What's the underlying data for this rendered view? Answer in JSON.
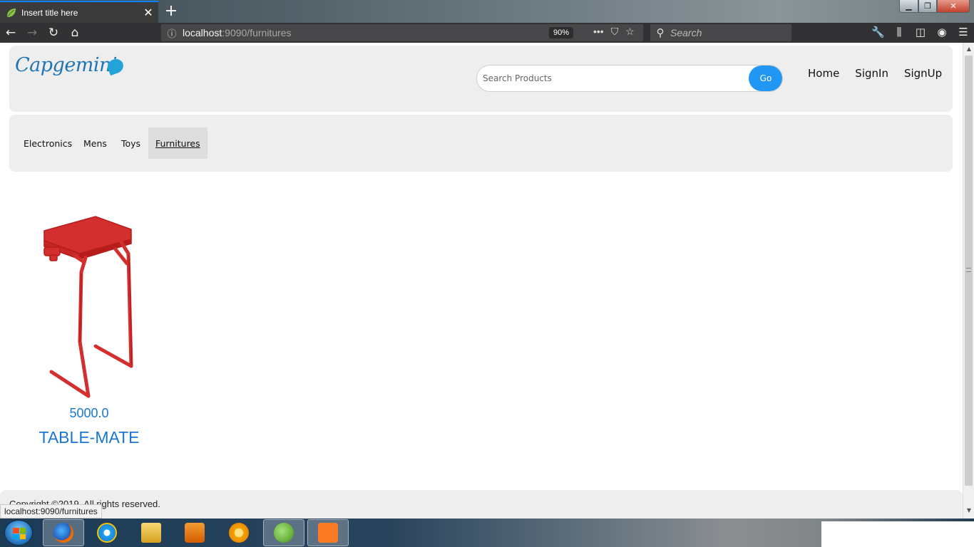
{
  "browser": {
    "tab_title": "Insert title here",
    "tab_close": "✕",
    "new_tab": "+",
    "url_host": "localhost",
    "url_path": ":9090/furnitures",
    "zoom": "90%",
    "search_placeholder": "Search",
    "status_url": "localhost:9090/furnitures",
    "window_controls": {
      "min": "▁",
      "max": "❐",
      "close": "✕"
    }
  },
  "header": {
    "logo_text": "Capgemini",
    "search_placeholder": "Search Products",
    "go_label": "Go",
    "links": [
      "Home",
      "SignIn",
      "SignUp"
    ]
  },
  "categories": [
    {
      "label": "Electronics",
      "active": false
    },
    {
      "label": "Mens",
      "active": false
    },
    {
      "label": "Toys",
      "active": false
    },
    {
      "label": "Furnitures",
      "active": true
    }
  ],
  "products": [
    {
      "price": "5000.0",
      "name": "TABLE-MATE",
      "color": "#d32f2f"
    }
  ],
  "footer": {
    "text": "Copyright ©2019. All rights reserved."
  },
  "taskbar": {
    "apps": [
      "firefox-icon",
      "internet-explorer-icon",
      "file-explorer-icon",
      "media-player-icon",
      "chrome-icon",
      "spring-tool-suite-icon",
      "xampp-icon"
    ]
  },
  "colors": {
    "accent": "#2196f3",
    "product_text": "#1976d2",
    "panel_bg": "#eeeeee"
  }
}
